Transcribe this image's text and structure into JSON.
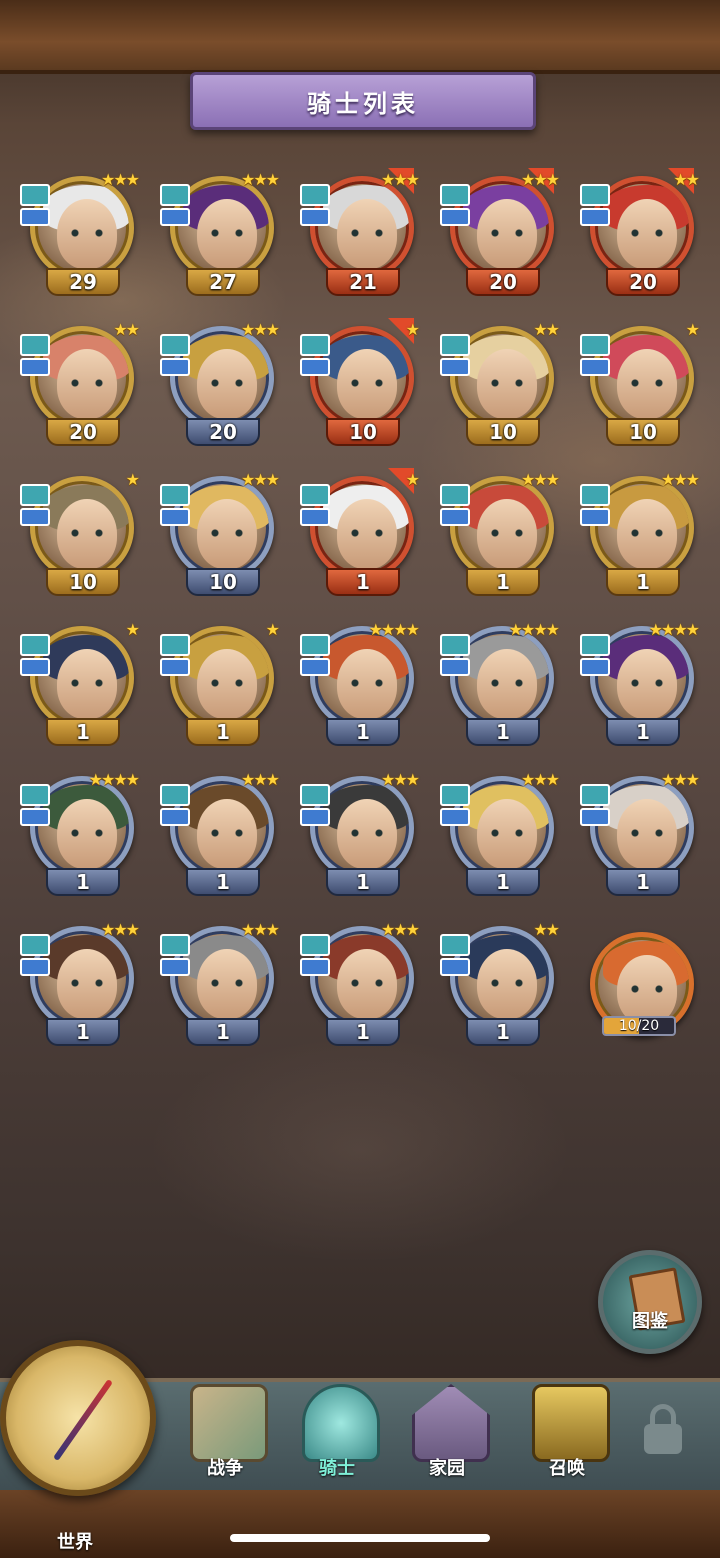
{
  "header": {
    "title": "骑士列表"
  },
  "knights": [
    {
      "level": "29",
      "stars": "★★★",
      "frame": "gold",
      "hair": "#e8e8e8"
    },
    {
      "level": "27",
      "stars": "★★★",
      "frame": "gold",
      "hair": "#5a2d7a"
    },
    {
      "level": "21",
      "stars": "★★★",
      "frame": "red",
      "hair": "#d8d8d8"
    },
    {
      "level": "20",
      "stars": "★★★",
      "frame": "red",
      "hair": "#7a3fa0"
    },
    {
      "level": "20",
      "stars": "★★",
      "frame": "red",
      "hair": "#c83a2e"
    },
    {
      "level": "20",
      "stars": "★★",
      "frame": "gold",
      "hair": "#d8826a"
    },
    {
      "level": "20",
      "stars": "★★★",
      "frame": "blue",
      "hair": "#c8a040"
    },
    {
      "level": "10",
      "stars": "★",
      "frame": "red",
      "hair": "#3a5a8a"
    },
    {
      "level": "10",
      "stars": "★★",
      "frame": "gold",
      "hair": "#e6d0a0"
    },
    {
      "level": "10",
      "stars": "★",
      "frame": "gold",
      "hair": "#d04a5a"
    },
    {
      "level": "10",
      "stars": "★",
      "frame": "gold",
      "hair": "#8a7a5a"
    },
    {
      "level": "10",
      "stars": "★★★",
      "frame": "blue",
      "hair": "#e0b860"
    },
    {
      "level": "1",
      "stars": "★",
      "frame": "red",
      "hair": "#eeeeee"
    },
    {
      "level": "1",
      "stars": "★★★",
      "frame": "gold",
      "hair": "#c84a3a"
    },
    {
      "level": "1",
      "stars": "★★★",
      "frame": "gold",
      "hair": "#c89a40"
    },
    {
      "level": "1",
      "stars": "★",
      "frame": "gold",
      "hair": "#2f3a5a"
    },
    {
      "level": "1",
      "stars": "★",
      "frame": "gold",
      "hair": "#c8a040"
    },
    {
      "level": "1",
      "stars": "★★★★",
      "frame": "blue",
      "hair": "#c8582e"
    },
    {
      "level": "1",
      "stars": "★★★★",
      "frame": "blue",
      "hair": "#9a9a9a"
    },
    {
      "level": "1",
      "stars": "★★★★",
      "frame": "blue",
      "hair": "#5a2d7a"
    },
    {
      "level": "1",
      "stars": "★★★★",
      "frame": "blue",
      "hair": "#3c5a3c"
    },
    {
      "level": "1",
      "stars": "★★★",
      "frame": "blue",
      "hair": "#6a4a2a"
    },
    {
      "level": "1",
      "stars": "★★★",
      "frame": "blue",
      "hair": "#3a3a3a"
    },
    {
      "level": "1",
      "stars": "★★★",
      "frame": "blue",
      "hair": "#e0c060"
    },
    {
      "level": "1",
      "stars": "★★★",
      "frame": "blue",
      "hair": "#d8d0c8"
    },
    {
      "level": "1",
      "stars": "★★★",
      "frame": "blue",
      "hair": "#5a3a2a"
    },
    {
      "level": "1",
      "stars": "★★★",
      "frame": "blue",
      "hair": "#8a8a8a"
    },
    {
      "level": "1",
      "stars": "★★★",
      "frame": "blue",
      "hair": "#8a3a2a"
    },
    {
      "level": "1",
      "stars": "★★",
      "frame": "blue",
      "hair": "#2a3a5a"
    }
  ],
  "fragment_knight": {
    "progress_text": "10/20",
    "progress": 0.5,
    "hair": "#d86a30"
  },
  "codex": {
    "label": "图鉴"
  },
  "nav": {
    "world": "世界",
    "war": "战争",
    "knights": "骑士",
    "home": "家园",
    "summon": "召唤"
  },
  "colors": {
    "title_banner": "#9a80c2",
    "gold_frame": "#c9a040",
    "blue_frame": "#8d9fc0",
    "red_frame": "#d05030",
    "star": "#ffd23a",
    "nav_active": "#7ff0d8"
  }
}
